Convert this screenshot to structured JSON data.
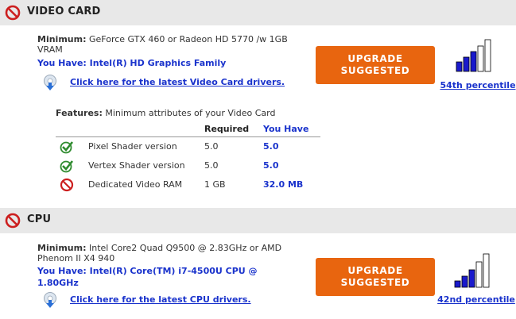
{
  "video": {
    "title": "VIDEO CARD",
    "minimum_label": "Minimum:",
    "minimum_text": "GeForce GTX 460 or Radeon HD 5770 /w 1GB VRAM",
    "you_have": "You Have: Intel(R) HD Graphics Family",
    "driver_link": "Click here for the latest Video Card drivers.",
    "upgrade_line1": "UPGRADE",
    "upgrade_line2": "SUGGESTED",
    "percentile": "54th percentile",
    "percentile_bars_filled": 3,
    "percentile_bars_total": 5,
    "features_label": "Features:",
    "features_desc": "Minimum attributes of your Video Card",
    "features_header": {
      "required": "Required",
      "you_have": "You Have"
    },
    "features": [
      {
        "name": "Pixel Shader version",
        "required": "5.0",
        "have": "5.0",
        "status": "pass"
      },
      {
        "name": "Vertex Shader version",
        "required": "5.0",
        "have": "5.0",
        "status": "pass"
      },
      {
        "name": "Dedicated Video RAM",
        "required": "1 GB",
        "have": "32.0 MB",
        "status": "fail"
      }
    ]
  },
  "cpu": {
    "title": "CPU",
    "minimum_label": "Minimum:",
    "minimum_text": "Intel Core2 Quad Q9500 @ 2.83GHz or AMD Phenom II X4 940",
    "you_have": "You Have: Intel(R) Core(TM) i7-4500U CPU @ 1.80GHz",
    "driver_link": "Click here for the latest CPU drivers.",
    "upgrade_line1": "UPGRADE",
    "upgrade_line2": "SUGGESTED",
    "percentile": "42nd percentile",
    "percentile_bars_filled": 3,
    "percentile_bars_total": 5
  },
  "colors": {
    "link": "#1a33cc",
    "button": "#e8650f",
    "fail": "#cc1f1f",
    "pass": "#2e8b2e",
    "header_bg": "#e8e8e8"
  }
}
